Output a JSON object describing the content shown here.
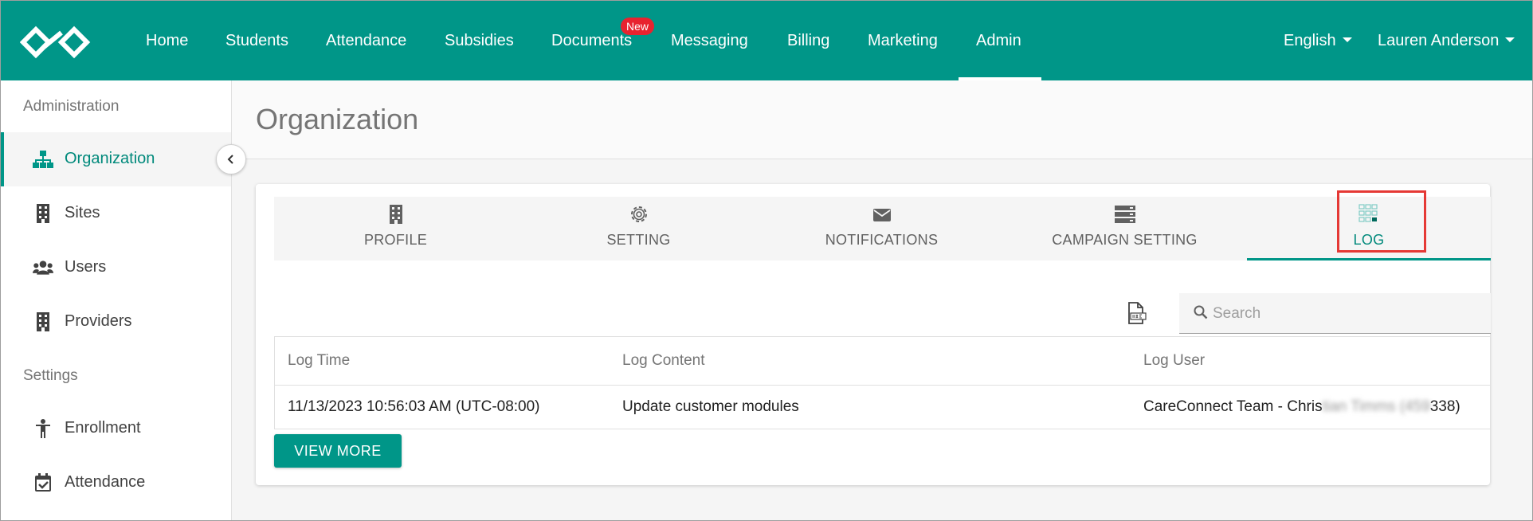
{
  "nav": {
    "items": [
      "Home",
      "Students",
      "Attendance",
      "Subsidies",
      "Documents",
      "Messaging",
      "Billing",
      "Marketing",
      "Admin"
    ],
    "active": "Admin",
    "documents_badge": "New",
    "language": "English",
    "user": "Lauren Anderson"
  },
  "sidebar": {
    "administration_heading": "Administration",
    "admin_items": [
      {
        "label": "Organization",
        "icon": "sitemap-icon",
        "active": true
      },
      {
        "label": "Sites",
        "icon": "building-icon"
      },
      {
        "label": "Users",
        "icon": "users-icon"
      },
      {
        "label": "Providers",
        "icon": "building-icon"
      }
    ],
    "settings_heading": "Settings",
    "settings_items": [
      {
        "label": "Enrollment",
        "icon": "person-icon"
      },
      {
        "label": "Attendance",
        "icon": "calendar-check-icon"
      }
    ]
  },
  "page": {
    "title": "Organization"
  },
  "tabs": [
    {
      "label": "PROFILE",
      "icon": "building-icon"
    },
    {
      "label": "SETTING",
      "icon": "gear-icon"
    },
    {
      "label": "NOTIFICATIONS",
      "icon": "envelope-icon"
    },
    {
      "label": "CAMPAIGN SETTING",
      "icon": "server-icon"
    },
    {
      "label": "LOG",
      "icon": "grid-icon",
      "active": true
    }
  ],
  "search": {
    "placeholder": "Search"
  },
  "log_table": {
    "headers": [
      "Log Time",
      "Log Content",
      "Log User"
    ],
    "rows": [
      {
        "time": "11/13/2023 10:56:03 AM",
        "timezone": "(UTC-08:00)",
        "content": "Update customer modules",
        "user_prefix": "CareConnect Team - Chris",
        "user_redacted": "tian Timms (459",
        "user_suffix": "338)"
      }
    ]
  },
  "view_more_label": "VIEW MORE",
  "colors": {
    "primary": "#009688",
    "primary_text": "#00897b",
    "badge": "#e8232f",
    "highlight": "#e53935"
  }
}
